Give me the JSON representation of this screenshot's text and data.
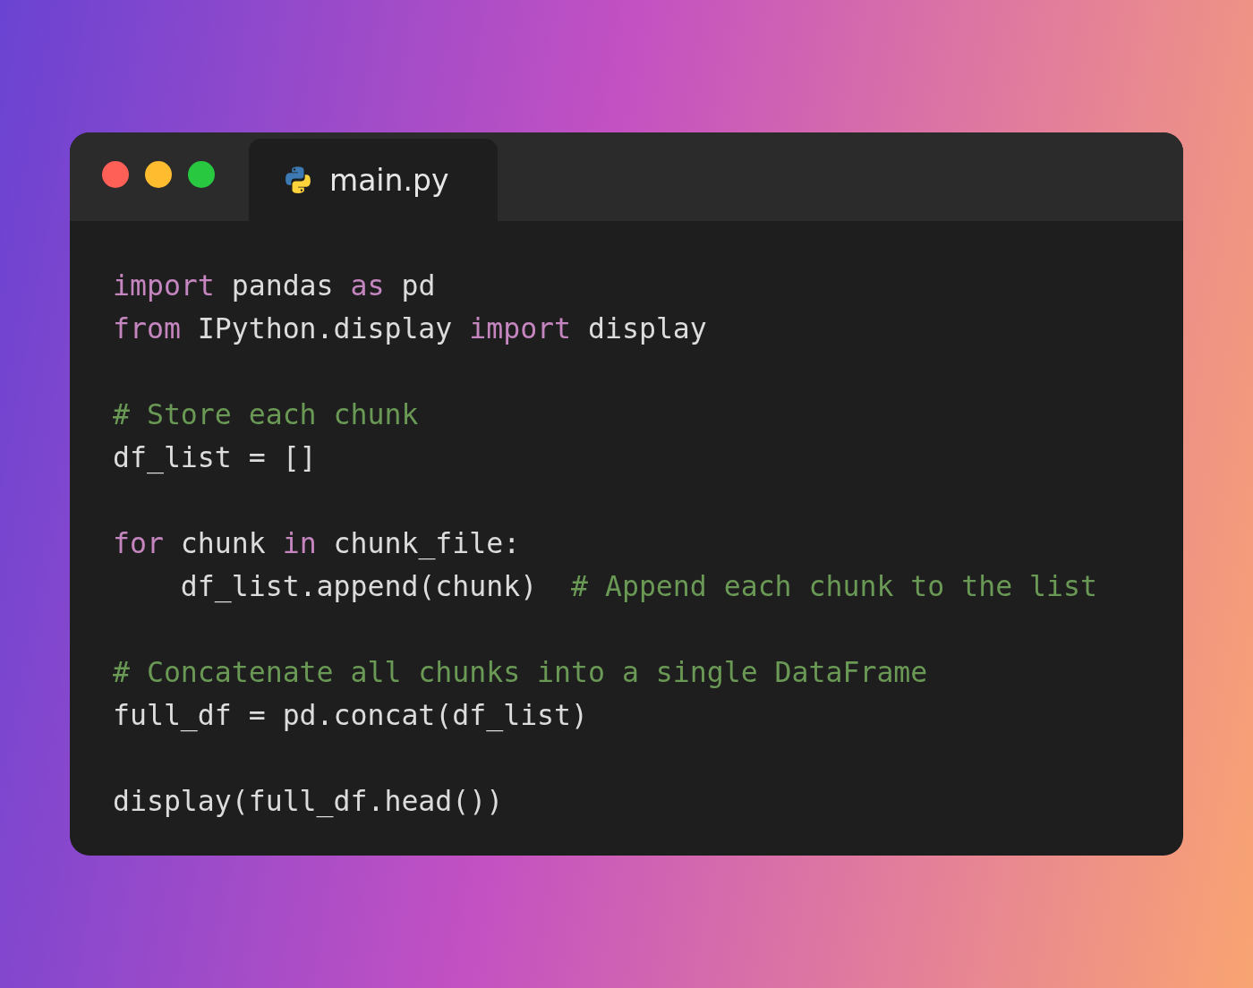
{
  "window": {
    "tab": {
      "label": "main.py",
      "selected": true
    }
  },
  "code": {
    "blocks": [
      [
        [
          {
            "kind": "keyword",
            "text": "import"
          },
          {
            "kind": "plain",
            "text": " pandas "
          },
          {
            "kind": "keyword",
            "text": "as"
          },
          {
            "kind": "plain",
            "text": " pd"
          }
        ],
        [
          {
            "kind": "keyword",
            "text": "from"
          },
          {
            "kind": "plain",
            "text": " IPython.display "
          },
          {
            "kind": "keyword",
            "text": "import"
          },
          {
            "kind": "plain",
            "text": " display"
          }
        ]
      ],
      [
        [
          {
            "kind": "comment",
            "text": "# Store each chunk"
          }
        ],
        [
          {
            "kind": "plain",
            "text": "df_list = []"
          }
        ]
      ],
      [
        [
          {
            "kind": "keyword",
            "text": "for"
          },
          {
            "kind": "plain",
            "text": " chunk "
          },
          {
            "kind": "keyword",
            "text": "in"
          },
          {
            "kind": "plain",
            "text": " chunk_file:"
          }
        ],
        [
          {
            "kind": "plain",
            "text": "    df_list.append(chunk)  "
          },
          {
            "kind": "comment",
            "text": "# Append each chunk to the list"
          }
        ]
      ],
      [
        [
          {
            "kind": "comment",
            "text": "# Concatenate all chunks into a single DataFrame"
          }
        ],
        [
          {
            "kind": "plain",
            "text": "full_df = pd.concat(df_list)"
          }
        ]
      ],
      [
        [
          {
            "kind": "plain",
            "text": "display(full_df.head())"
          }
        ]
      ]
    ]
  }
}
